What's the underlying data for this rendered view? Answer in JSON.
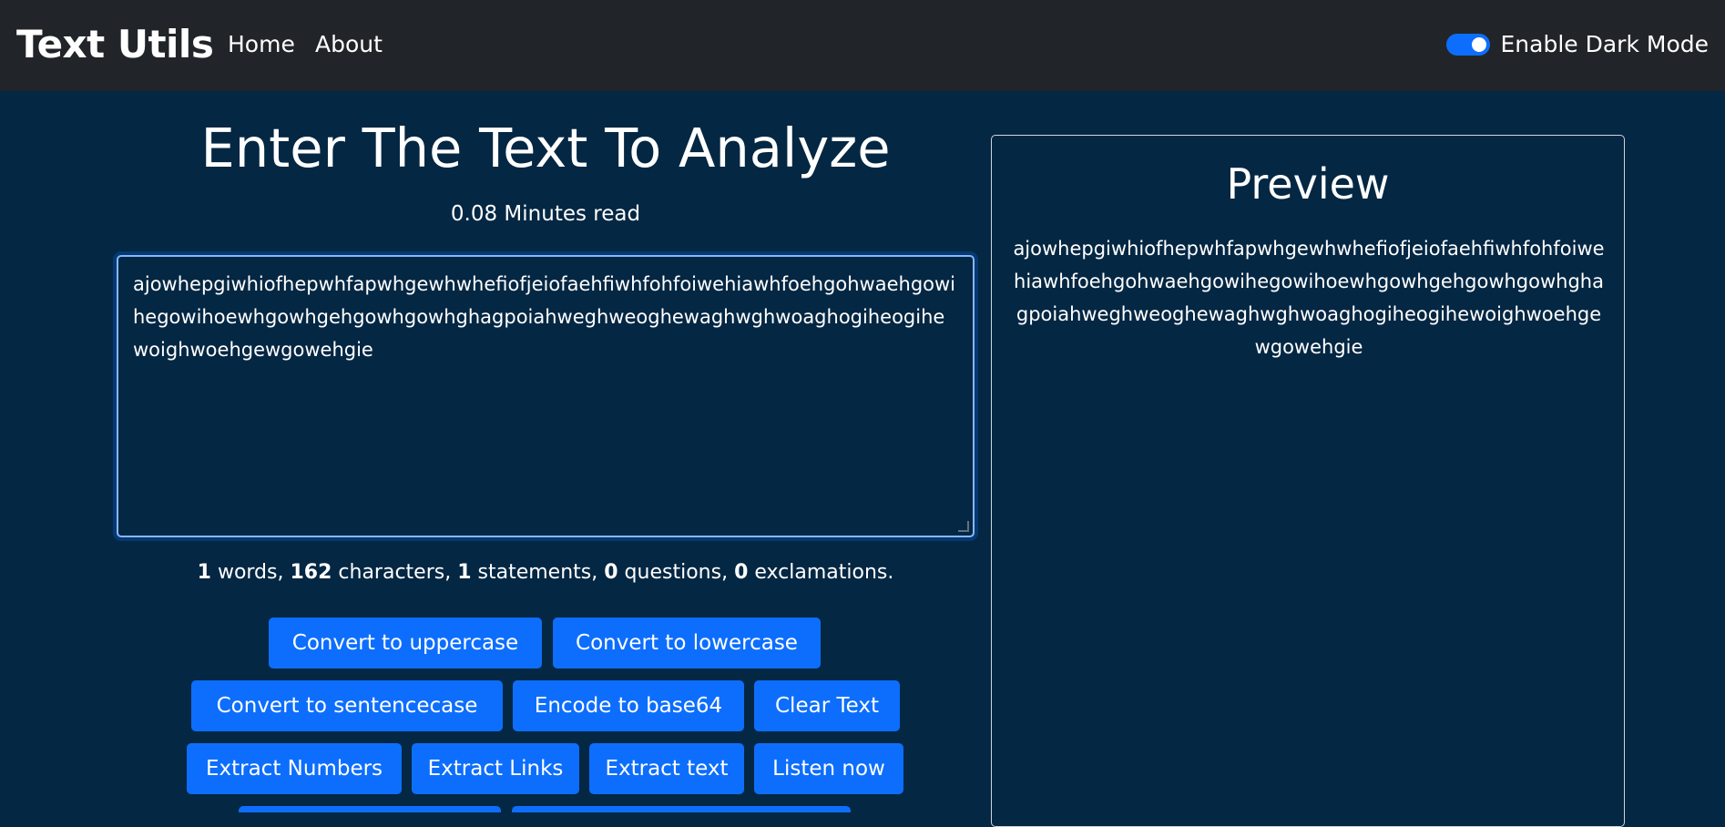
{
  "navbar": {
    "brand": "Text Utils",
    "links": [
      "Home",
      "About"
    ],
    "toggle_label": "Enable Dark Mode",
    "toggle_on": true
  },
  "main": {
    "heading": "Enter The Text To Analyze",
    "read_time": "0.08 Minutes read",
    "text": "ajowhepgiwhiofhepwhfapwhgewhwhefiofjeiofaehfiwhfohfoiwehiawhfoehgohwaehgowihegowihoewhgowhgehgowhgowhghagpoiahweghweoghewaghwghwoaghogiheogihewoighwoehgewgowehgie",
    "stats": {
      "words": "1",
      "words_label": " words, ",
      "characters": "162",
      "characters_label": " characters, ",
      "statements": "1",
      "statements_label": " statements, ",
      "questions": "0",
      "questions_label": " questions, ",
      "exclamations": "0",
      "exclamations_label": " exclamations."
    },
    "buttons": {
      "uppercase": "Convert to uppercase",
      "lowercase": "Convert to lowercase",
      "sentencecase": "Convert to sentencecase",
      "base64": "Encode to base64",
      "clear": "Clear Text",
      "numbers": "Extract Numbers",
      "links": "Extract Links",
      "extract_text": "Extract text",
      "listen": "Listen now"
    }
  },
  "preview": {
    "title": "Preview",
    "text": "ajowhepgiwhiofhepwhfapwhgewhwhefiofjeiofaehfiwhfohfoiwehiawhfoehgohwaehgowihegowihoewhgowhgehgowhgowhghagpoiahweghweoghewaghwghwoaghogiheogihewoighwoehgewgowehgie"
  },
  "colors": {
    "navbar_bg": "#212529",
    "page_bg": "#042743",
    "button_bg": "#0d6efd"
  }
}
